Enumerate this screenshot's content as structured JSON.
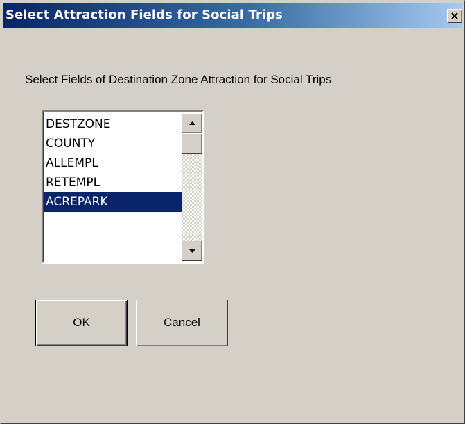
{
  "window": {
    "title": "Select Attraction Fields for Social Trips"
  },
  "prompt": "Select Fields of Destination Zone Attraction for Social Trips",
  "listbox": {
    "items": [
      {
        "label": "DESTZONE",
        "selected": false
      },
      {
        "label": "COUNTY",
        "selected": false
      },
      {
        "label": "ALLEMPL",
        "selected": false
      },
      {
        "label": "RETEMPL",
        "selected": false
      },
      {
        "label": "ACREPARK",
        "selected": true
      }
    ]
  },
  "buttons": {
    "ok": "OK",
    "cancel": "Cancel"
  },
  "colors": {
    "title_bar_start": "#0a246a",
    "title_bar_end": "#a6caf0",
    "selection": "#0a246a",
    "face": "#d4d0c8"
  },
  "icons": {
    "close": "close-icon",
    "scroll_up": "scroll-up-arrow-icon",
    "scroll_down": "scroll-down-arrow-icon"
  }
}
